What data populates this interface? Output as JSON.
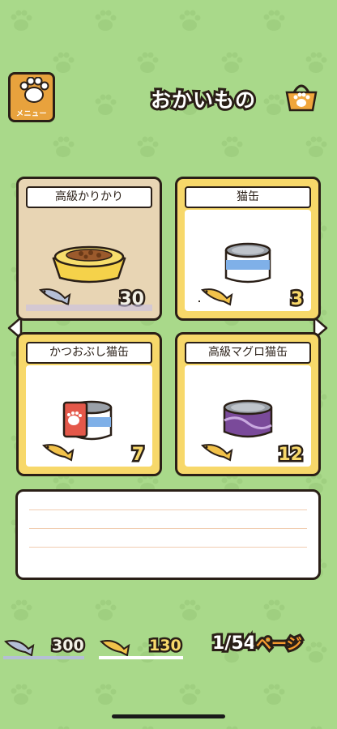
{
  "header": {
    "menu_label": "メニュー",
    "title": "おかいもの",
    "basket_icon": "basket-paw-icon"
  },
  "items": [
    {
      "name": "高級かりかり",
      "price": "30",
      "currency": "silver",
      "image": "food-bowl-icon",
      "selected": true
    },
    {
      "name": "猫缶",
      "price": "3",
      "currency": "gold",
      "image": "cat-can-blue-icon",
      "selected": false
    },
    {
      "name": "かつおぶし猫缶",
      "price": "7",
      "currency": "gold",
      "image": "bonito-can-icon",
      "selected": false
    },
    {
      "name": "高級マグロ猫缶",
      "price": "12",
      "currency": "gold",
      "image": "tuna-can-icon",
      "selected": false
    }
  ],
  "wallet": {
    "silver_fish": "300",
    "gold_fish": "130"
  },
  "pagination": {
    "page": "1/54",
    "suffix": "ページ"
  },
  "colors": {
    "background": "#a9d98a",
    "card": "#f7d86a",
    "selected_card": "#e8d5b4",
    "accent": "#e8a23d"
  }
}
